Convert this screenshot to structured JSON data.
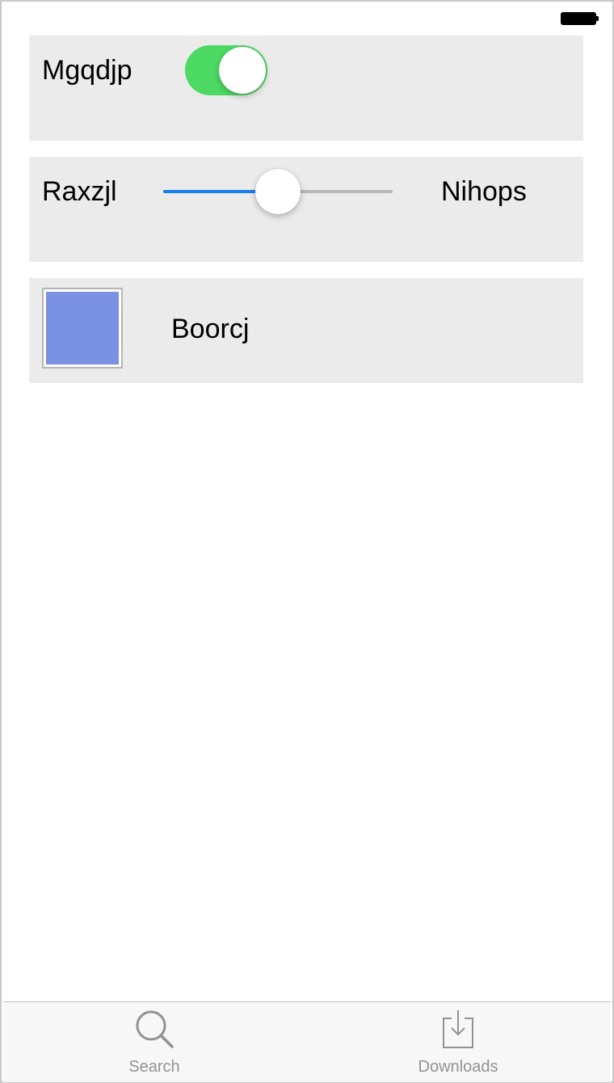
{
  "rows": {
    "toggle": {
      "label": "Mgqdjp",
      "on": true,
      "on_color": "#4cd964"
    },
    "slider": {
      "label_left": "Raxzjl",
      "label_right": "Nihops",
      "value": 0.5,
      "fill_color": "#1a7ef0"
    },
    "color": {
      "label": "Boorcj",
      "swatch_color": "#7b91e4"
    }
  },
  "tabbar": {
    "items": [
      {
        "label": "Search",
        "icon": "search-icon"
      },
      {
        "label": "Downloads",
        "icon": "download-tray-icon"
      }
    ]
  }
}
